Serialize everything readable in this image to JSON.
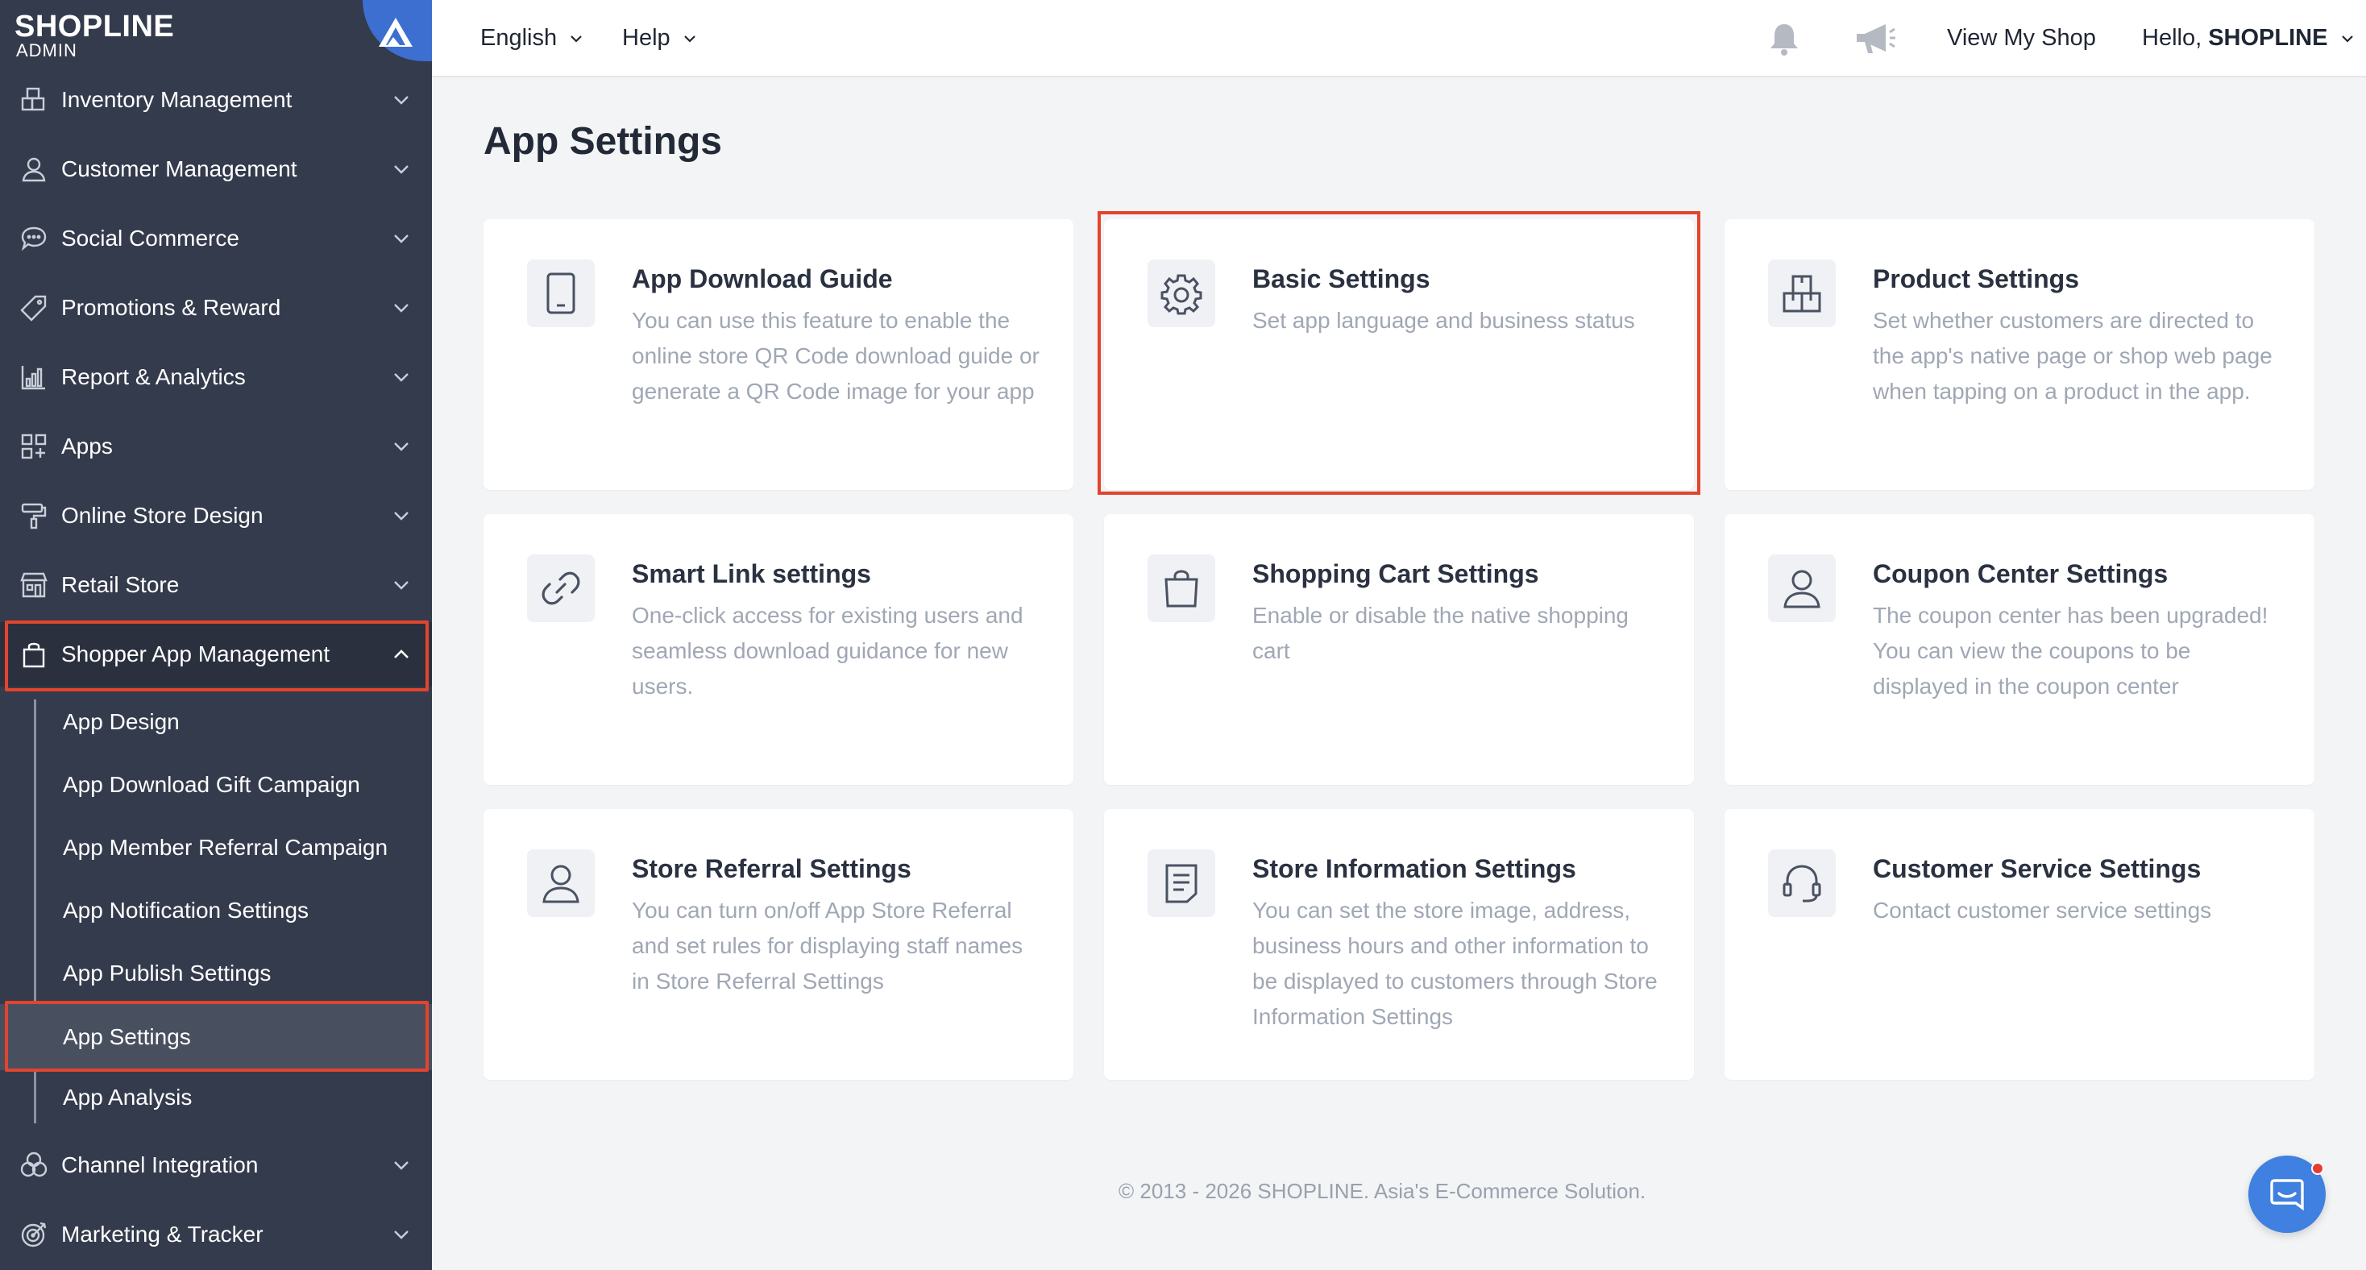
{
  "brand": {
    "name": "SHOPLINE",
    "sub": "ADMIN"
  },
  "sidebar": {
    "items": [
      {
        "label": "Inventory Management",
        "icon": "inventory-icon"
      },
      {
        "label": "Customer Management",
        "icon": "customer-icon"
      },
      {
        "label": "Social Commerce",
        "icon": "chat-bubble-icon"
      },
      {
        "label": "Promotions & Reward",
        "icon": "tag-icon"
      },
      {
        "label": "Report & Analytics",
        "icon": "bar-chart-icon"
      },
      {
        "label": "Apps",
        "icon": "apps-grid-icon"
      },
      {
        "label": "Online Store Design",
        "icon": "paint-roller-icon"
      },
      {
        "label": "Retail Store",
        "icon": "store-icon"
      },
      {
        "label": "Shopper App Management",
        "icon": "shopping-bag-icon"
      },
      {
        "label": "Channel Integration",
        "icon": "channels-icon"
      },
      {
        "label": "Marketing & Tracker",
        "icon": "target-icon"
      }
    ],
    "subitems": [
      {
        "label": "App Design"
      },
      {
        "label": "App Download Gift Campaign"
      },
      {
        "label": "App Member Referral Campaign"
      },
      {
        "label": "App Notification Settings"
      },
      {
        "label": "App Publish Settings"
      },
      {
        "label": "App Settings"
      },
      {
        "label": "App Analysis"
      }
    ]
  },
  "topbar": {
    "language": "English",
    "help": "Help",
    "view_shop": "View My Shop",
    "greeting": "Hello,",
    "user": "SHOPLINE"
  },
  "main": {
    "title": "App Settings",
    "cards": [
      {
        "title": "App Download Guide",
        "desc": "You can use this feature to enable the online store QR Code download guide or generate a QR Code image for your app",
        "icon": "tablet-icon"
      },
      {
        "title": "Basic Settings",
        "desc": "Set app language and business status",
        "icon": "gear-icon"
      },
      {
        "title": "Product Settings",
        "desc": "Set whether customers are directed to the app's native page or shop web page when tapping on a product in the app.",
        "icon": "boxes-icon"
      },
      {
        "title": "Smart Link settings",
        "desc": "One-click access for existing users and seamless download guidance for new users.",
        "icon": "link-icon"
      },
      {
        "title": "Shopping Cart Settings",
        "desc": "Enable or disable the native shopping cart",
        "icon": "shopping-bag-icon"
      },
      {
        "title": "Coupon Center Settings",
        "desc": "The coupon center has been upgraded! You can view the coupons to be displayed in the coupon center",
        "icon": "user-icon"
      },
      {
        "title": "Store Referral Settings",
        "desc": "You can turn on/off App Store Referral and set rules for displaying staff names in Store Referral Settings",
        "icon": "user-icon"
      },
      {
        "title": "Store Information Settings",
        "desc": "You can set the store image, address, business hours and other information to be displayed to customers through Store Information Settings",
        "icon": "document-icon"
      },
      {
        "title": "Customer Service Settings",
        "desc": "Contact customer service settings",
        "icon": "headset-icon"
      }
    ]
  },
  "footer": {
    "text": "© 2013 - 2026  SHOPLINE. Asia's E-Commerce Solution."
  },
  "colors": {
    "sidebar": "#343b4c",
    "accent": "#3d6fd1",
    "highlight": "#e2452d",
    "chat": "#3f80e0"
  }
}
